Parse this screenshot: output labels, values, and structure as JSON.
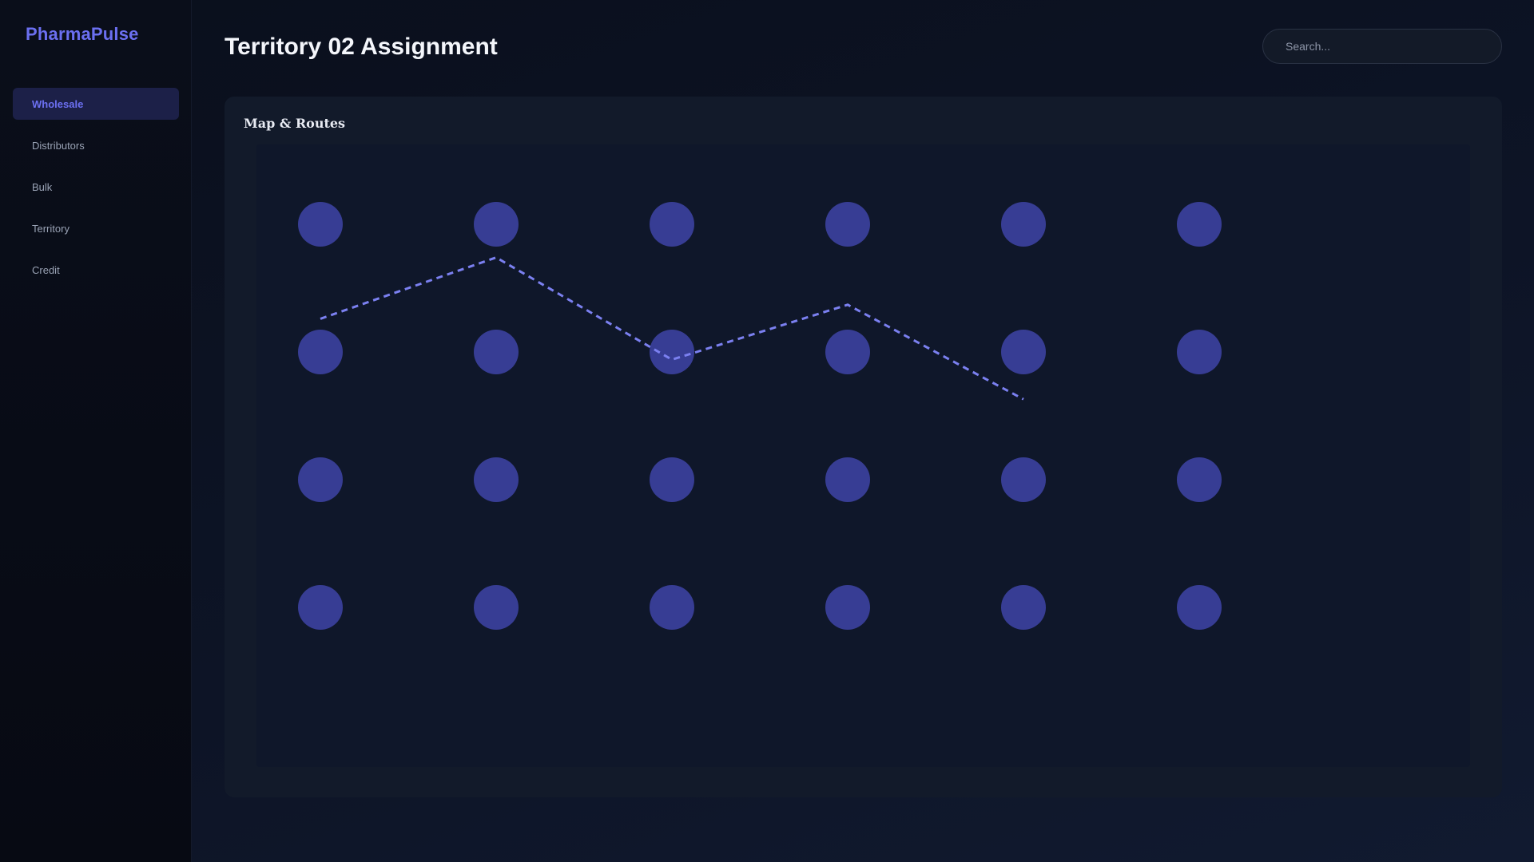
{
  "app": {
    "brand": "PharmaPulse"
  },
  "sidebar": {
    "items": [
      {
        "label": "Wholesale",
        "active": true
      },
      {
        "label": "Distributors",
        "active": false
      },
      {
        "label": "Bulk",
        "active": false
      },
      {
        "label": "Territory",
        "active": false
      },
      {
        "label": "Credit",
        "active": false
      }
    ]
  },
  "header": {
    "title": "Territory 02 Assignment",
    "search_placeholder": "Search..."
  },
  "panel": {
    "title": "Map & Routes",
    "grid": {
      "columns": 6,
      "rows": 4
    },
    "route": [
      {
        "col": 0,
        "row": 0.74
      },
      {
        "col": 1,
        "row": 0.26
      },
      {
        "col": 2,
        "row": 1.06
      },
      {
        "col": 3,
        "row": 0.63
      },
      {
        "col": 4,
        "row": 1.37
      }
    ]
  },
  "colors": {
    "accent": "#6c70f2",
    "marker": "#3a3f9a",
    "route": "#7b80f0",
    "nav_active_bg": "#1c2048"
  }
}
